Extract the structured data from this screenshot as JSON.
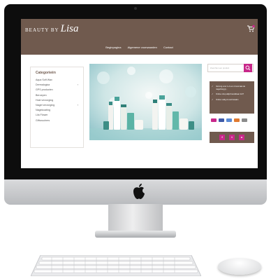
{
  "site": {
    "logo_prefix": "BEAUTY BY",
    "logo_script": "Lisa",
    "nav": [
      "Beginpagina",
      "Algemene voorwaarden",
      "Contact"
    ],
    "sidebar_title": "Categorieën",
    "categories": [
      "Aqua Soft Wax",
      "Dermalogica",
      "GPS producten",
      "Beroepen",
      "Huid verzorging",
      "Nagel verzorging",
      "Nagelcoating",
      "Lila Flower",
      "Giftvouchers"
    ],
    "search_placeholder": "Zoek hier een product",
    "usp": [
      "Verzorg voor 1-2 uur of snel laat de nagelzorg jij...",
      "Online shop altijd bereikbaar 24/7",
      "Online veilig & snel betalen"
    ]
  },
  "colors": {
    "brand_brown": "#705a4e",
    "accent_pink": "#c8288a"
  },
  "icons": [
    "apple-logo-icon",
    "cart-icon",
    "search-icon",
    "check-icon",
    "facebook-icon",
    "twitter-icon",
    "instagram-icon"
  ]
}
